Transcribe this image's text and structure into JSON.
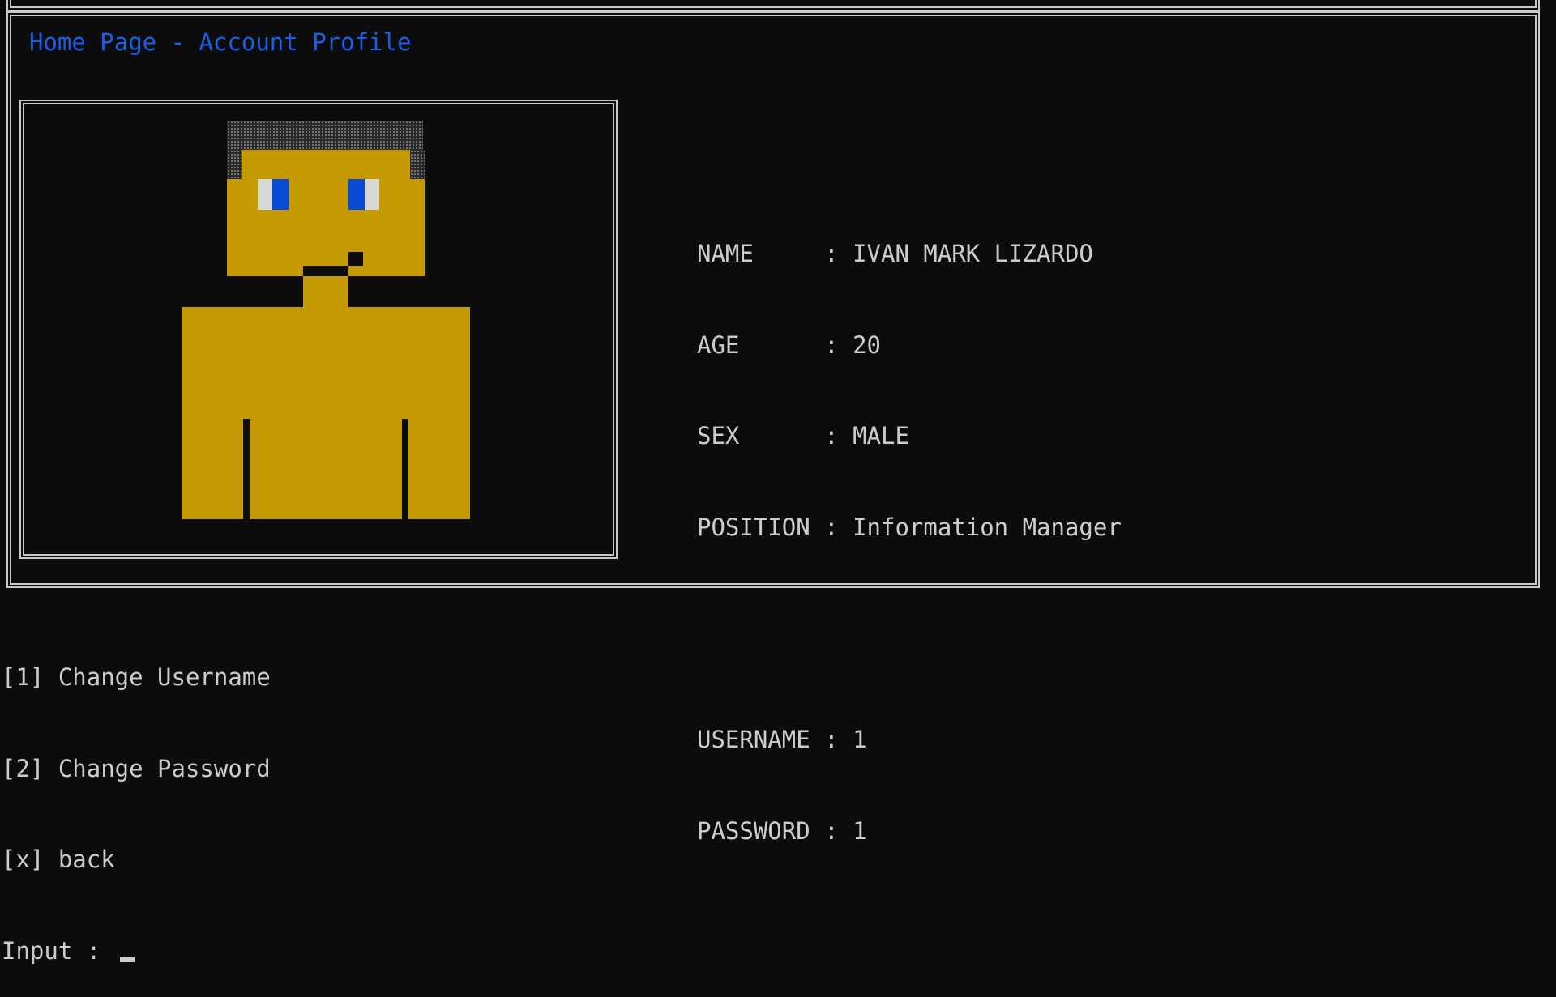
{
  "header": {
    "title": "Home Page - Account Profile"
  },
  "profile": {
    "name_label": "NAME     : ",
    "name": "IVAN MARK LIZARDO",
    "age_label": "AGE      : ",
    "age": "20",
    "sex_label": "SEX      : ",
    "sex": "MALE",
    "position_label": "POSITION : ",
    "position": "Information Manager",
    "username_label": "USERNAME : ",
    "username": "1",
    "password_label": "PASSWORD : ",
    "password": "1"
  },
  "menu": {
    "items": [
      "[1] Change Username",
      "[2] Change Password",
      "[x] back"
    ],
    "input_label": "Input : "
  },
  "colors": {
    "background": "#0c0c0c",
    "text": "#cccccc",
    "title": "#1a5ee8",
    "skin": "#c49a00",
    "eye": "#0a4bd6"
  }
}
